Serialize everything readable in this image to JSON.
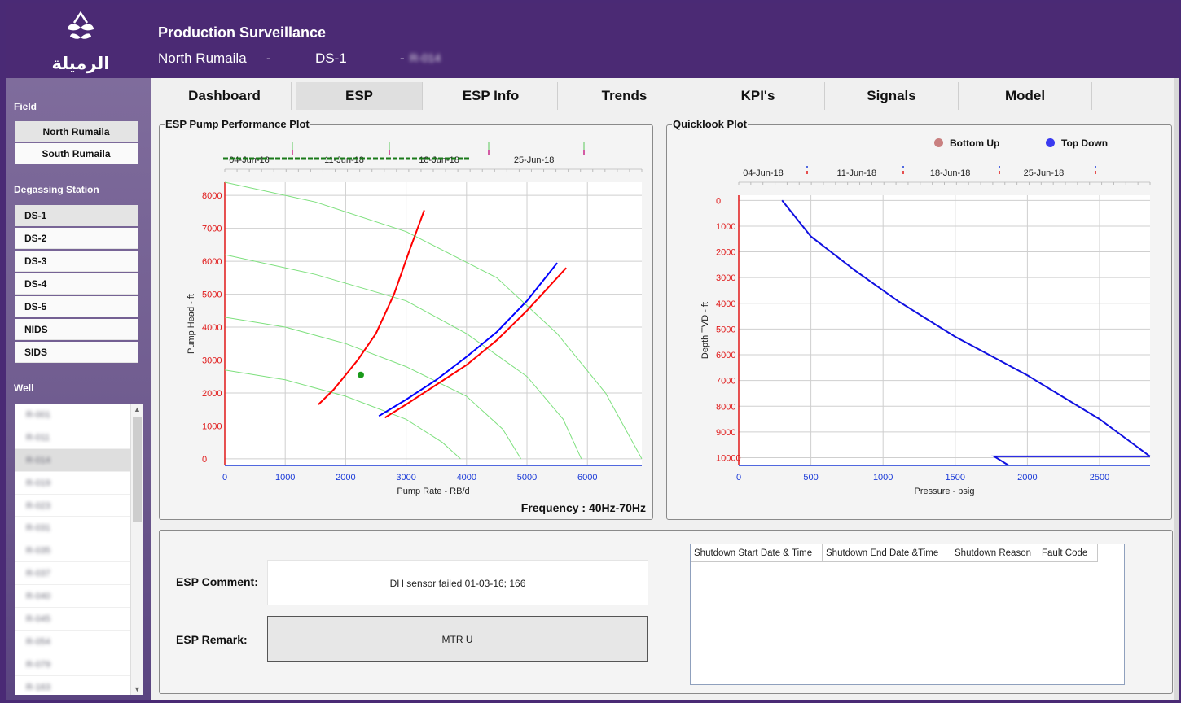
{
  "header": {
    "logo_text": "الرميلة",
    "title": "Production Surveillance",
    "field": "North Rumaila",
    "sep1": "-",
    "station": "DS-1",
    "sep2": "-",
    "well": "R-014"
  },
  "sidebar": {
    "field_label": "Field",
    "fields": [
      "North Rumaila",
      "South Rumaila"
    ],
    "degassing_label": "Degassing Station",
    "stations": [
      "DS-1",
      "DS-2",
      "DS-3",
      "DS-4",
      "DS-5",
      "NIDS",
      "SIDS"
    ],
    "well_label": "Well",
    "wells": [
      "R-001",
      "R-011",
      "R-014",
      "R-019",
      "R-023",
      "R-031",
      "R-035",
      "R-037",
      "R-040",
      "R-045",
      "R-054",
      "R-079",
      "R-163"
    ]
  },
  "tabs": [
    "Dashboard",
    "ESP",
    "ESP Info",
    "Trends",
    "KPI's",
    "Signals",
    "Model"
  ],
  "esp_panel": {
    "title": "ESP Pump Performance Plot",
    "frequency_label": "Frequency  : 40Hz-70Hz"
  },
  "quicklook_panel": {
    "title": "Quicklook Plot",
    "legend": [
      {
        "label": "Bottom Up",
        "color": "#c98080"
      },
      {
        "label": "Top Down",
        "color": "#3a3af0"
      }
    ]
  },
  "chart_data": [
    {
      "type": "line",
      "xlabel": "Pump Rate - RB/d",
      "ylabel": "Pump Head - ft",
      "xlim": [
        0,
        6900
      ],
      "ylim": [
        -200,
        8400
      ],
      "xticks": [
        0,
        1000,
        2000,
        3000,
        4000,
        5000,
        6000
      ],
      "yticks": [
        0,
        1000,
        2000,
        3000,
        4000,
        5000,
        6000,
        7000,
        8000
      ],
      "timeline_dates": [
        "04-Jun-18",
        "11-Jun-18",
        "18-Jun-18",
        "25-Jun-18"
      ],
      "grid": true,
      "series": [
        {
          "color": "#7ee07e",
          "points": [
            [
              0,
              8400
            ],
            [
              1500,
              7800
            ],
            [
              3000,
              6900
            ],
            [
              4500,
              5500
            ],
            [
              5500,
              3800
            ],
            [
              6300,
              2000
            ],
            [
              6900,
              0
            ]
          ]
        },
        {
          "color": "#7ee07e",
          "points": [
            [
              0,
              6200
            ],
            [
              1500,
              5600
            ],
            [
              3000,
              4800
            ],
            [
              4000,
              3800
            ],
            [
              5000,
              2500
            ],
            [
              5600,
              1200
            ],
            [
              5900,
              0
            ]
          ]
        },
        {
          "color": "#7ee07e",
          "points": [
            [
              0,
              4300
            ],
            [
              1000,
              4000
            ],
            [
              2000,
              3500
            ],
            [
              3000,
              2800
            ],
            [
              4000,
              1900
            ],
            [
              4600,
              900
            ],
            [
              4900,
              0
            ]
          ]
        },
        {
          "color": "#7ee07e",
          "points": [
            [
              0,
              2700
            ],
            [
              1000,
              2400
            ],
            [
              2000,
              1900
            ],
            [
              3000,
              1200
            ],
            [
              3600,
              500
            ],
            [
              3900,
              0
            ]
          ]
        },
        {
          "color": "#ff0000",
          "points": [
            [
              1550,
              1650
            ],
            [
              1800,
              2100
            ],
            [
              2200,
              3000
            ],
            [
              2500,
              3800
            ],
            [
              2800,
              5000
            ],
            [
              3050,
              6300
            ],
            [
              3300,
              7550
            ]
          ]
        },
        {
          "color": "#ff0000",
          "points": [
            [
              2650,
              1250
            ],
            [
              3000,
              1650
            ],
            [
              3500,
              2250
            ],
            [
              4000,
              2850
            ],
            [
              4500,
              3600
            ],
            [
              5000,
              4500
            ],
            [
              5400,
              5300
            ],
            [
              5650,
              5800
            ]
          ]
        },
        {
          "color": "#0000ff",
          "points": [
            [
              2550,
              1300
            ],
            [
              3000,
              1800
            ],
            [
              3500,
              2400
            ],
            [
              4000,
              3100
            ],
            [
              4500,
              3850
            ],
            [
              5000,
              4800
            ],
            [
              5500,
              5950
            ]
          ]
        }
      ],
      "operating_point": {
        "x": 2250,
        "y": 2550,
        "color": "#1a9a1a"
      }
    },
    {
      "type": "line",
      "xlabel": "Pressure - psig",
      "ylabel": "Depth TVD - ft",
      "xlim": [
        0,
        2850
      ],
      "ylim": [
        10300,
        -200
      ],
      "xticks": [
        0,
        500,
        1000,
        1500,
        2000,
        2500
      ],
      "yticks": [
        0,
        1000,
        2000,
        3000,
        4000,
        5000,
        6000,
        7000,
        8000,
        9000,
        10000
      ],
      "timeline_dates": [
        "04-Jun-18",
        "11-Jun-18",
        "18-Jun-18",
        "25-Jun-18"
      ],
      "grid": true,
      "series": [
        {
          "name": "Top Down",
          "color": "#1010e0",
          "points": [
            [
              300,
              0
            ],
            [
              500,
              1400
            ],
            [
              800,
              2700
            ],
            [
              1100,
              3900
            ],
            [
              1500,
              5300
            ],
            [
              2000,
              6800
            ],
            [
              2500,
              8500
            ],
            [
              2850,
              9950
            ]
          ]
        },
        {
          "name": "Top Down",
          "color": "#1010e0",
          "points": [
            [
              2850,
              9950
            ],
            [
              1770,
              9950
            ],
            [
              1870,
              10300
            ]
          ]
        }
      ]
    }
  ],
  "bottom": {
    "comment_label": "ESP Comment:",
    "comment_value": "DH sensor failed 01-03-16; 166",
    "remark_label": "ESP Remark:",
    "remark_value": "MTR U",
    "table_headers": [
      "Shutdown Start Date & Time",
      "Shutdown End Date &Time",
      "Shutdown Reason",
      "Fault Code"
    ]
  }
}
